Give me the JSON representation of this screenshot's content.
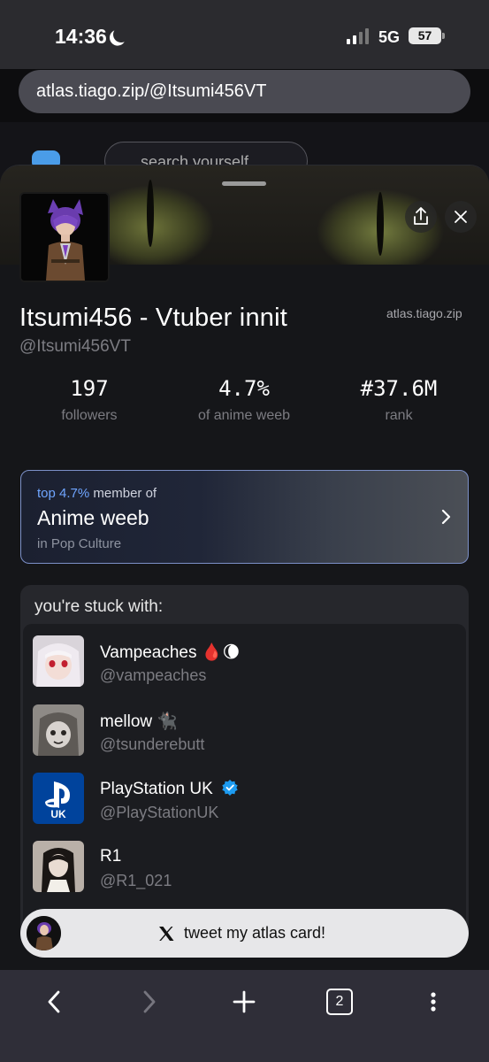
{
  "status_bar": {
    "time": "14:36",
    "network": "5G",
    "battery": "57"
  },
  "browser": {
    "url": "atlas.tiago.zip/@Itsumi456VT",
    "tab_count": "2",
    "background_search_placeholder": "search yourself"
  },
  "profile": {
    "display_name": "Itsumi456 - Vtuber innit",
    "handle": "@Itsumi456VT",
    "site": "atlas.tiago.zip",
    "stats": [
      {
        "value": "197",
        "label": "followers"
      },
      {
        "value": "4.7%",
        "label": "of anime weeb"
      },
      {
        "value": "#37.6M",
        "label": "rank"
      }
    ]
  },
  "community": {
    "prefix": "top",
    "percent": "4.7%",
    "suffix": "member of",
    "name": "Anime weeb",
    "category": "in Pop Culture"
  },
  "stuck_with": {
    "title": "you're stuck with:",
    "items": [
      {
        "name": "Vampeaches",
        "emoji": "🩸🌘",
        "handle": "@vampeaches"
      },
      {
        "name": "mellow",
        "emoji": "🐈‍⬛",
        "handle": "@tsunderebutt"
      },
      {
        "name": "PlayStation UK",
        "emoji": "",
        "handle": "@PlayStationUK",
        "verified": true,
        "avatar_text": "UK"
      },
      {
        "name": "R1",
        "emoji": "",
        "handle": "@R1_021"
      }
    ]
  },
  "cta": {
    "label": "tweet my atlas card!"
  },
  "colors": {
    "accent": "#6fa5ff",
    "community_border": "#7c90c8",
    "verified": "#1d9bf0"
  }
}
